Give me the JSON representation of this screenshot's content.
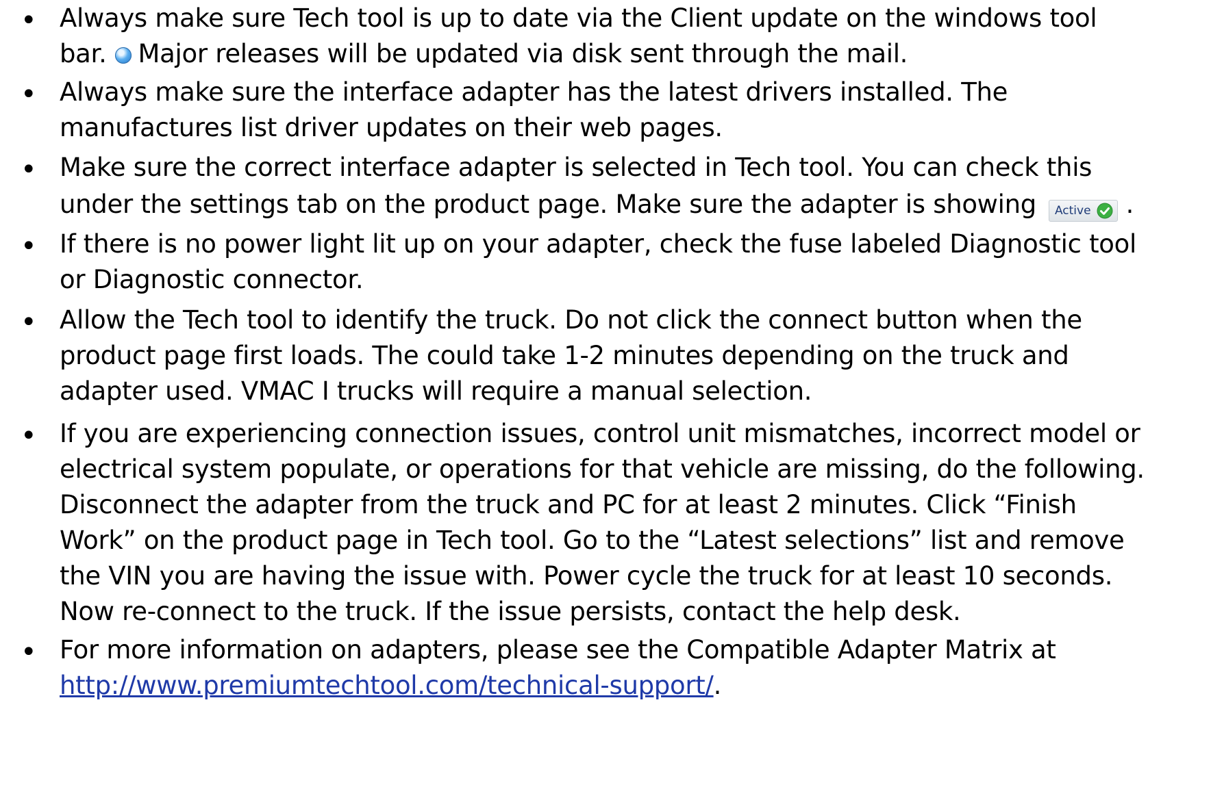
{
  "bullets": [
    {
      "lines": [
        "Always make sure Tech tool is up to date via the Client update on the windows tool",
        "bar.",
        "Major releases will be updated via disk sent through the mail."
      ]
    },
    {
      "lines": [
        "Always make sure the interface adapter has the latest drivers installed. The",
        "manufactures list driver updates on their web pages."
      ]
    },
    {
      "lines": [
        "Make sure the correct interface adapter is selected in Tech tool. You can check this",
        "under the settings tab on the product page. Make sure the adapter is showing",
        "."
      ],
      "badge_label": "Active"
    },
    {
      "lines": [
        "If there is no power light lit up on your adapter, check the fuse labeled Diagnostic tool",
        "or Diagnostic connector."
      ]
    },
    {
      "lines": [
        "Allow the Tech tool to identify the truck. Do not click the connect button when the",
        "product page first loads. The could take 1-2 minutes depending on the truck and",
        "adapter used. VMAC I trucks will require a manual selection."
      ]
    },
    {
      "lines": [
        "If you are experiencing connection issues, control unit mismatches, incorrect model or",
        "electrical system populate, or operations for that vehicle are missing, do the  following.",
        "Disconnect the adapter from the truck and PC for at least 2 minutes. Click “Finish",
        "Work” on the product page in Tech tool. Go to the “Latest selections” list and remove",
        "the VIN you are having the issue with. Power cycle the truck for at least 10 seconds.",
        "Now re-connect to the truck. If the issue persists, contact the help desk."
      ]
    },
    {
      "lines": [
        "For more information on adapters, please see the Compatible Adapter Matrix at",
        "."
      ],
      "link_text": "http://www.premiumtechtool.com/technical-support/"
    }
  ],
  "bullet_symbol": "•",
  "icons": {
    "client_update": "globe-icon",
    "active_status": "green-check-icon"
  },
  "colors": {
    "link": "#1f3aa8",
    "badge_text": "#1f3c78",
    "check_green": "#3cb043"
  }
}
